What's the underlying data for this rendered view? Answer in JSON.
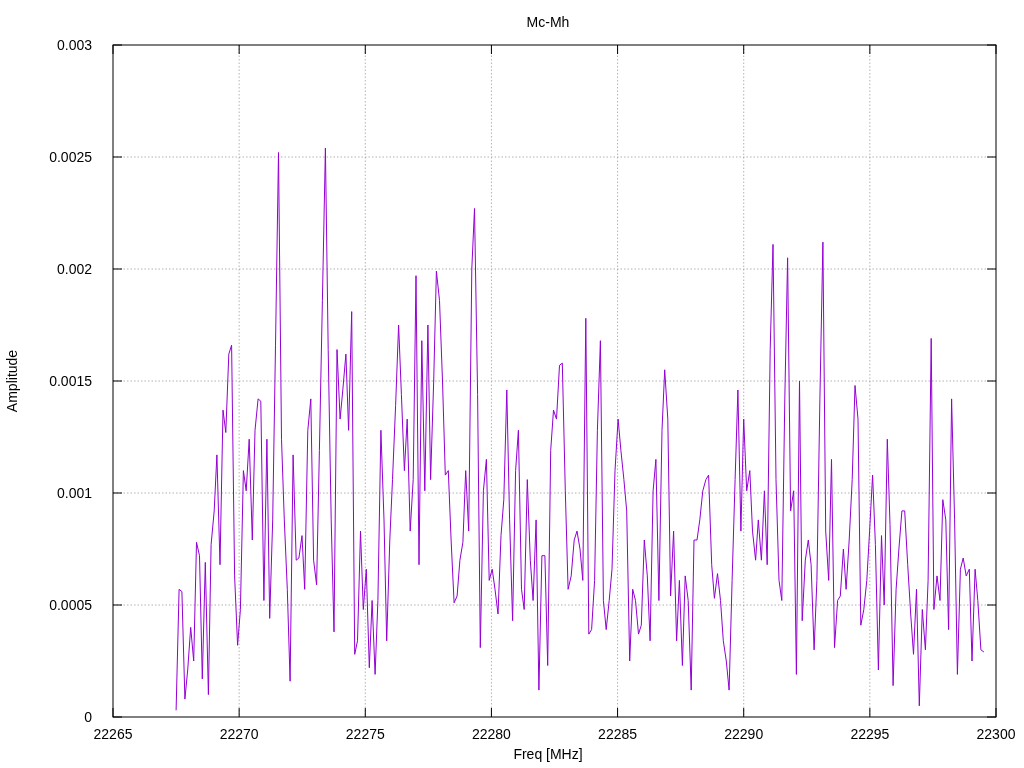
{
  "chart": {
    "chart_data": {
      "type": "line",
      "grid": true,
      "title": "Mc-Mh",
      "xlabel": "Freq [MHz]",
      "ylabel": "Amplitude",
      "xlim": [
        22265,
        22300
      ],
      "ylim": [
        0,
        0.003
      ],
      "xticks": [
        22265,
        22270,
        22275,
        22280,
        22285,
        22290,
        22295,
        22300
      ],
      "yticks": [
        0,
        0.0005,
        0.001,
        0.0015,
        0.002,
        0.0025,
        0.003
      ],
      "x": [
        22267.5,
        22267.62,
        22267.73,
        22267.85,
        22267.96,
        22268.08,
        22268.2,
        22268.31,
        22268.43,
        22268.54,
        22268.66,
        22268.78,
        22268.89,
        22269.01,
        22269.12,
        22269.24,
        22269.36,
        22269.47,
        22269.59,
        22269.7,
        22269.82,
        22269.94,
        22270.05,
        22270.17,
        22270.28,
        22270.4,
        22270.52,
        22270.63,
        22270.75,
        22270.86,
        22270.98,
        22271.1,
        22271.21,
        22271.33,
        22271.44,
        22271.56,
        22271.68,
        22271.79,
        22271.91,
        22272.02,
        22272.14,
        22272.26,
        22272.37,
        22272.49,
        22272.6,
        22272.72,
        22272.84,
        22272.95,
        22273.07,
        22273.18,
        22273.3,
        22273.42,
        22273.53,
        22273.65,
        22273.76,
        22273.88,
        22274,
        22274.11,
        22274.23,
        22274.34,
        22274.46,
        22274.58,
        22274.69,
        22274.81,
        22274.92,
        22275.04,
        22275.16,
        22275.27,
        22275.39,
        22275.5,
        22275.62,
        22275.74,
        22275.85,
        22275.97,
        22276.08,
        22276.2,
        22276.32,
        22276.43,
        22276.55,
        22276.66,
        22276.78,
        22276.9,
        22277.01,
        22277.13,
        22277.24,
        22277.36,
        22277.48,
        22277.59,
        22277.71,
        22277.82,
        22277.94,
        22278.06,
        22278.17,
        22278.29,
        22278.4,
        22278.52,
        22278.64,
        22278.75,
        22278.87,
        22278.98,
        22279.1,
        22279.22,
        22279.33,
        22279.45,
        22279.56,
        22279.68,
        22279.8,
        22279.91,
        22280.03,
        22280.14,
        22280.26,
        22280.38,
        22280.49,
        22280.61,
        22280.72,
        22280.84,
        22280.96,
        22281.07,
        22281.19,
        22281.3,
        22281.42,
        22281.54,
        22281.65,
        22281.77,
        22281.88,
        22282,
        22282.12,
        22282.23,
        22282.35,
        22282.46,
        22282.58,
        22282.7,
        22282.81,
        22282.93,
        22283.04,
        22283.16,
        22283.28,
        22283.39,
        22283.51,
        22283.62,
        22283.74,
        22283.86,
        22283.97,
        22284.09,
        22284.2,
        22284.32,
        22284.44,
        22284.55,
        22284.67,
        22284.78,
        22284.9,
        22285.02,
        22285.13,
        22285.25,
        22285.36,
        22285.48,
        22285.6,
        22285.71,
        22285.83,
        22285.94,
        22286.06,
        22286.18,
        22286.29,
        22286.41,
        22286.52,
        22286.64,
        22286.76,
        22286.87,
        22286.99,
        22287.1,
        22287.22,
        22287.34,
        22287.45,
        22287.57,
        22287.68,
        22287.8,
        22287.92,
        22288.03,
        22288.15,
        22288.26,
        22288.38,
        22288.5,
        22288.61,
        22288.73,
        22288.84,
        22288.96,
        22289.08,
        22289.19,
        22289.31,
        22289.42,
        22289.54,
        22289.66,
        22289.77,
        22289.89,
        22290,
        22290.12,
        22290.24,
        22290.35,
        22290.47,
        22290.58,
        22290.7,
        22290.82,
        22290.93,
        22291.05,
        22291.16,
        22291.28,
        22291.4,
        22291.51,
        22291.63,
        22291.74,
        22291.86,
        22291.98,
        22292.09,
        22292.21,
        22292.32,
        22292.44,
        22292.56,
        22292.67,
        22292.79,
        22292.9,
        22293.02,
        22293.14,
        22293.25,
        22293.37,
        22293.48,
        22293.6,
        22293.72,
        22293.83,
        22293.95,
        22294.06,
        22294.18,
        22294.3,
        22294.41,
        22294.53,
        22294.64,
        22294.76,
        22294.88,
        22294.99,
        22295.11,
        22295.22,
        22295.34,
        22295.46,
        22295.57,
        22295.69,
        22295.8,
        22295.92,
        22296.04,
        22296.15,
        22296.27,
        22296.38,
        22296.5,
        22296.62,
        22296.73,
        22296.85,
        22296.96,
        22297.08,
        22297.2,
        22297.31,
        22297.43,
        22297.54,
        22297.66,
        22297.78,
        22297.89,
        22298.01,
        22298.12,
        22298.24,
        22298.36,
        22298.47,
        22298.59,
        22298.7,
        22298.82,
        22298.94,
        22299.05,
        22299.17,
        22299.28,
        22299.4,
        22299.52
      ],
      "series": [
        {
          "color": "#9400d3",
          "values": [
            3e-05,
            0.00057,
            0.00056,
            8e-05,
            0.00021,
            0.0004,
            0.00025,
            0.00078,
            0.00072,
            0.00017,
            0.00069,
            0.0001,
            0.00077,
            0.00092,
            0.00117,
            0.00068,
            0.00137,
            0.00127,
            0.00162,
            0.00166,
            0.00063,
            0.00032,
            0.00048,
            0.0011,
            0.00101,
            0.00124,
            0.00079,
            0.00128,
            0.00142,
            0.00141,
            0.00052,
            0.00124,
            0.00044,
            0.00088,
            0.00166,
            0.00252,
            0.00124,
            0.00088,
            0.00057,
            0.00016,
            0.00117,
            0.0007,
            0.00071,
            0.00081,
            0.00057,
            0.00128,
            0.00142,
            0.0007,
            0.00059,
            0.00119,
            0.00186,
            0.00254,
            0.00164,
            0.00088,
            0.00038,
            0.00164,
            0.00133,
            0.00146,
            0.00162,
            0.00128,
            0.00181,
            0.00028,
            0.00034,
            0.00083,
            0.00048,
            0.00066,
            0.00022,
            0.00052,
            0.00019,
            0.00052,
            0.00128,
            0.00088,
            0.00034,
            0.00079,
            0.00106,
            0.00139,
            0.00175,
            0.00144,
            0.0011,
            0.00133,
            0.00083,
            0.00106,
            0.00197,
            0.00068,
            0.00168,
            0.00101,
            0.00175,
            0.00106,
            0.0015,
            0.00199,
            0.00186,
            0.0015,
            0.00108,
            0.0011,
            0.00079,
            0.00051,
            0.00054,
            0.0007,
            0.00078,
            0.0011,
            0.00083,
            0.002,
            0.00227,
            0.00144,
            0.00031,
            0.00101,
            0.00115,
            0.00061,
            0.00066,
            0.00057,
            0.00046,
            0.00081,
            0.00097,
            0.00146,
            0.00088,
            0.00043,
            0.0011,
            0.00128,
            0.00057,
            0.00048,
            0.00106,
            0.0007,
            0.00052,
            0.00088,
            0.00012,
            0.00072,
            0.00072,
            0.00023,
            0.00119,
            0.00137,
            0.00133,
            0.00157,
            0.00158,
            0.00101,
            0.00057,
            0.00063,
            0.00079,
            0.00083,
            0.00075,
            0.00061,
            0.00178,
            0.00037,
            0.00039,
            0.00061,
            0.00128,
            0.00168,
            0.00052,
            0.00039,
            0.00052,
            0.00066,
            0.0011,
            0.00133,
            0.00119,
            0.00106,
            0.00092,
            0.00025,
            0.00057,
            0.00052,
            0.00037,
            0.00041,
            0.00079,
            0.00063,
            0.00034,
            0.00101,
            0.00115,
            0.00052,
            0.00128,
            0.00155,
            0.00133,
            0.00054,
            0.00083,
            0.00034,
            0.00061,
            0.00023,
            0.00063,
            0.00052,
            0.00012,
            0.00079,
            0.00079,
            0.00088,
            0.00101,
            0.00106,
            0.00108,
            0.00068,
            0.00053,
            0.00064,
            0.00052,
            0.00034,
            0.00025,
            0.00012,
            0.00061,
            0.00106,
            0.00146,
            0.00083,
            0.00133,
            0.00101,
            0.0011,
            0.00083,
            0.0007,
            0.00088,
            0.0007,
            0.00101,
            0.00068,
            0.00164,
            0.00211,
            0.00106,
            0.00061,
            0.00052,
            0.00142,
            0.00205,
            0.00092,
            0.00101,
            0.00019,
            0.0015,
            0.00043,
            0.0007,
            0.00079,
            0.00068,
            0.0003,
            0.00061,
            0.00142,
            0.00212,
            0.00083,
            0.00061,
            0.00115,
            0.00031,
            0.00052,
            0.00054,
            0.00075,
            0.00057,
            0.00079,
            0.00106,
            0.00148,
            0.00133,
            0.00041,
            0.00048,
            0.00061,
            0.00083,
            0.00108,
            0.00077,
            0.00021,
            0.00081,
            0.0005,
            0.00124,
            0.00086,
            0.00014,
            0.00057,
            0.00075,
            0.00092,
            0.00092,
            0.00068,
            0.00046,
            0.00028,
            0.00057,
            5e-05,
            0.00048,
            0.0003,
            0.00061,
            0.00169,
            0.00048,
            0.00063,
            0.00052,
            0.00097,
            0.00088,
            0.00039,
            0.00142,
            0.00088,
            0.00019,
            0.00066,
            0.00071,
            0.00063,
            0.00066,
            0.00025,
            0.00066,
            0.00052,
            0.0003,
            0.00029
          ]
        }
      ]
    }
  }
}
